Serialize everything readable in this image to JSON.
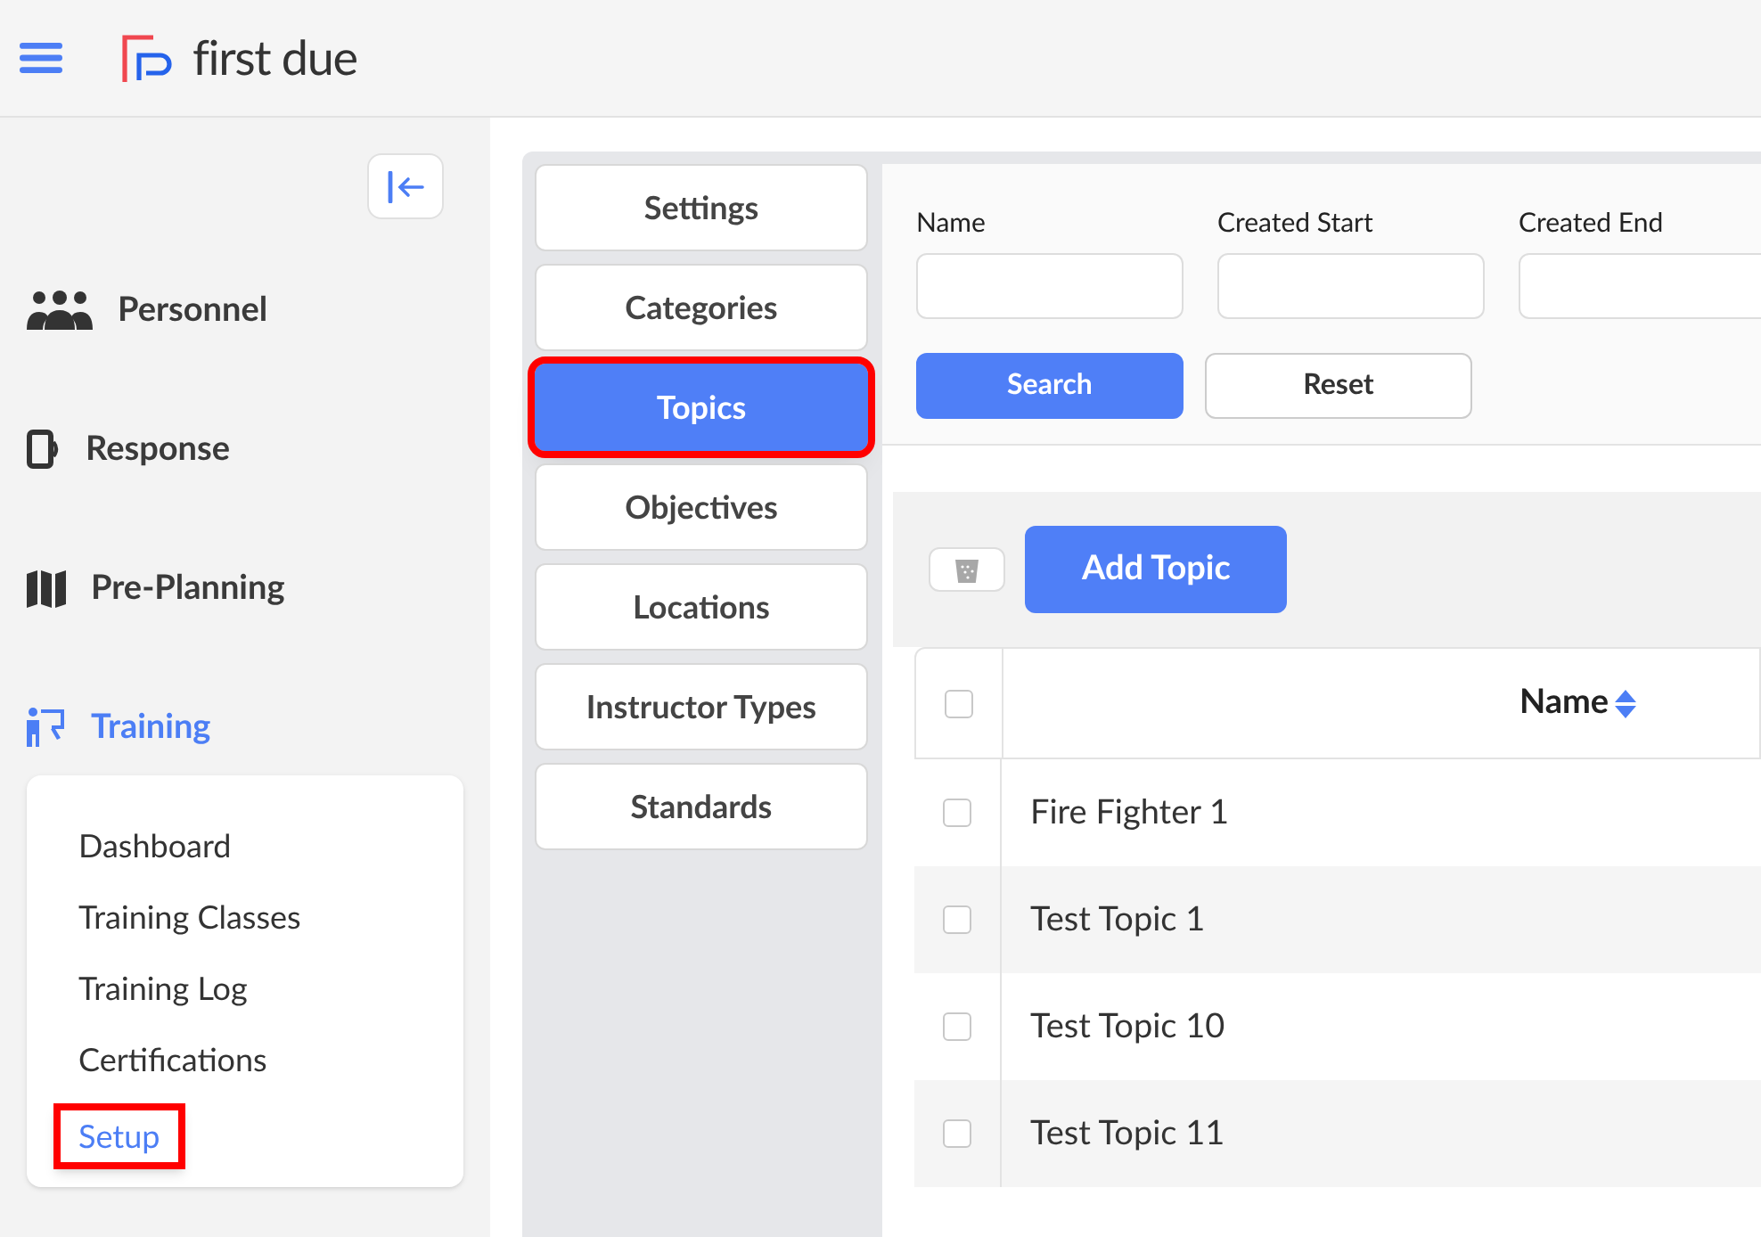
{
  "header": {
    "brand": "first due"
  },
  "sidebar": {
    "items": [
      {
        "label": "Personnel",
        "kind": "people",
        "selected": false
      },
      {
        "label": "Response",
        "kind": "device",
        "selected": false
      },
      {
        "label": "Pre-Planning",
        "kind": "map",
        "selected": false
      },
      {
        "label": "Training",
        "kind": "trainer",
        "selected": true
      }
    ],
    "submenu": [
      {
        "label": "Dashboard",
        "selected": false,
        "highlighted": false
      },
      {
        "label": "Training Classes",
        "selected": false,
        "highlighted": false
      },
      {
        "label": "Training Log",
        "selected": false,
        "highlighted": false
      },
      {
        "label": "Certifications",
        "selected": false,
        "highlighted": false
      },
      {
        "label": "Setup",
        "selected": true,
        "highlighted": true
      }
    ]
  },
  "tabs": [
    {
      "label": "Settings",
      "selected": false,
      "highlighted": false
    },
    {
      "label": "Categories",
      "selected": false,
      "highlighted": false
    },
    {
      "label": "Topics",
      "selected": true,
      "highlighted": true
    },
    {
      "label": "Objectives",
      "selected": false,
      "highlighted": false
    },
    {
      "label": "Locations",
      "selected": false,
      "highlighted": false
    },
    {
      "label": "Instructor Types",
      "selected": false,
      "highlighted": false
    },
    {
      "label": "Standards",
      "selected": false,
      "highlighted": false
    }
  ],
  "filters": {
    "fields": [
      {
        "label": "Name"
      },
      {
        "label": "Created Start"
      },
      {
        "label": "Created End"
      }
    ],
    "buttons": [
      {
        "label": "Search",
        "kind": "primary"
      },
      {
        "label": "Reset",
        "kind": "secondary"
      }
    ]
  },
  "toolbar": {
    "add_button": "Add Topic"
  },
  "table": {
    "select_all": {
      "checked": false
    },
    "columns": [
      {
        "label": "Name",
        "sortable": true
      }
    ],
    "rows": [
      {
        "name": "Fire Fighter 1",
        "checked": false
      },
      {
        "name": "Test Topic 1",
        "checked": false
      },
      {
        "name": "Test Topic 10",
        "checked": false
      },
      {
        "name": "Test Topic 11",
        "checked": false
      }
    ]
  }
}
